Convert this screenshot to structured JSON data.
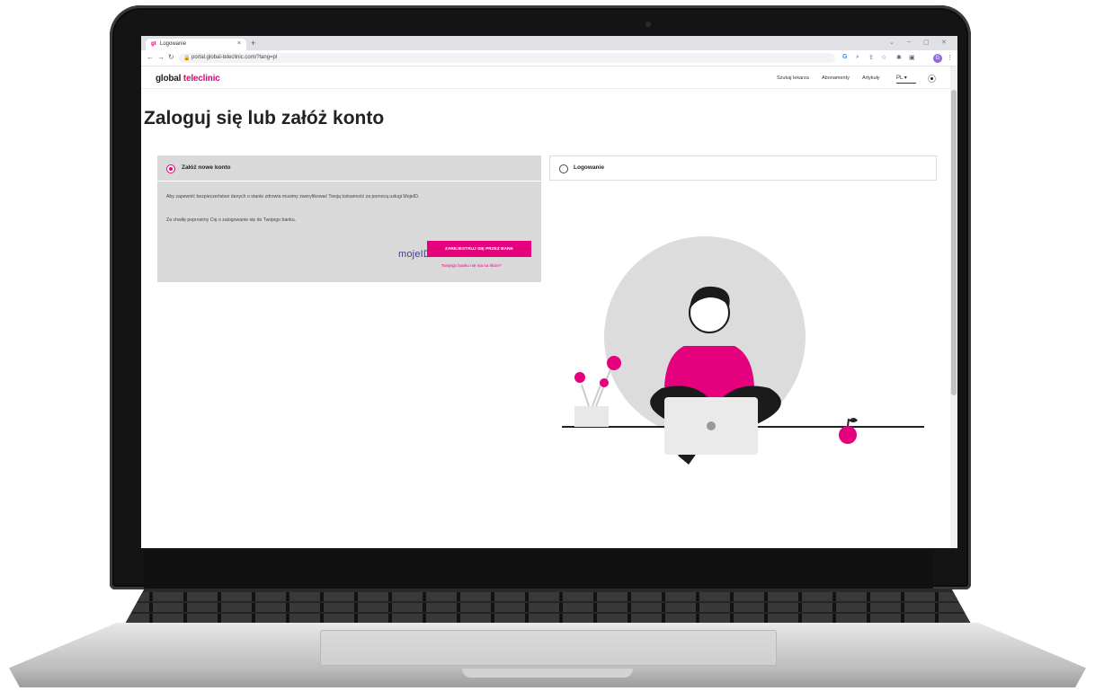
{
  "browser": {
    "tab_title": "Logowanie",
    "tab_favicon": "gt",
    "new_tab": "+",
    "tab_close": "×",
    "url": "portal.global-teleclinic.com/?lang=pl",
    "profile_initial": "G"
  },
  "site": {
    "logo_part1": "global",
    "logo_part2": "teleclinic",
    "nav": {
      "find_doctor": "Szukaj lekarza",
      "subscriptions": "Abonamenty",
      "articles": "Artykuły"
    },
    "language": "PL"
  },
  "page": {
    "title": "Zaloguj się lub załóż konto"
  },
  "register": {
    "option_label": "Załóż nowe konto",
    "text1": "Aby zapewnić bezpieczeństwo danych o stanie zdrowia musimy zweryfikować Twoją tożsamość za pomocą usługi MojeID.",
    "text2": "Za chwilę poprosimy Cię o zalogowanie się do Twojego banku.",
    "mojeid_logo": "mojeID",
    "button": "ZAREJESTRUJ SIĘ PRZEZ BANK",
    "missing_bank": "Twojego banku nie ma na liście?"
  },
  "login": {
    "option_label": "Logowanie"
  },
  "colors": {
    "brand_pink": "#e5007d",
    "panel_grey": "#d9d9d9"
  }
}
